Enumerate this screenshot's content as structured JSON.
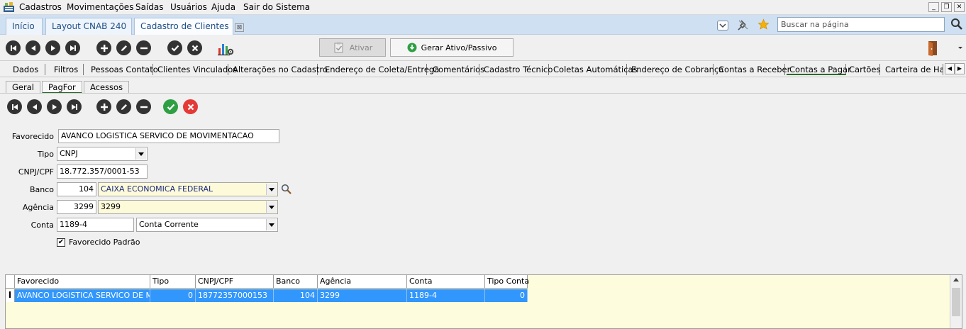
{
  "menu": {
    "items": [
      "Cadastros",
      "Movimentações",
      "Saídas",
      "Usuários",
      "Ajuda",
      "Sair do Sistema"
    ]
  },
  "window_controls": {
    "minimize": "_",
    "restore": "❐",
    "close": "✕"
  },
  "doc_tabs": [
    {
      "label": "Início"
    },
    {
      "label": "Layout CNAB 240"
    },
    {
      "label": "Cadastro de Clientes",
      "close": "⊠"
    }
  ],
  "search": {
    "placeholder": "Buscar na página",
    "value": ""
  },
  "toolbar": {
    "ativar_label": "Ativar",
    "gerar_label": "Gerar Ativo/Passivo"
  },
  "section_tabs": [
    "Dados",
    "Filtros",
    "Pessoas Contato",
    "Clientes Vinculados",
    "Alterações no Cadastro",
    "Endereço de Coleta/Entrega",
    "Comentários",
    "Cadastro Técnico",
    "Coletas Automáticas",
    "Endereço de Cobrança",
    "Contas a Receber",
    "Contas a Pagar",
    "Cartões",
    "Carteira de Habili"
  ],
  "active_section_tab": "Contas a Pagar",
  "sub_tabs": [
    "Geral",
    "PagFor",
    "Acessos"
  ],
  "active_sub_tab": "PagFor",
  "form": {
    "favorecido_label": "Favorecido",
    "favorecido_value": "AVANCO LOGISTICA SERVICO DE MOVIMENTACAO",
    "tipo_label": "Tipo",
    "tipo_value": "CNPJ",
    "cnpj_label": "CNPJ/CPF",
    "cnpj_value": "18.772.357/0001-53",
    "banco_label": "Banco",
    "banco_code": "104",
    "banco_name": "CAIXA ECONOMICA FEDERAL",
    "agencia_label": "Agência",
    "agencia_code": "3299",
    "agencia_value": "3299",
    "conta_label": "Conta",
    "conta_value": "1189-4",
    "conta_tipo": "Conta Corrente",
    "padrao_label": "Favorecido Padrão",
    "padrao_check": "✔"
  },
  "grid": {
    "columns": [
      "Favorecido",
      "Tipo",
      "CNPJ/CPF",
      "Banco",
      "Agência",
      "Conta",
      "Tipo Conta"
    ],
    "row_marker": "I",
    "rows": [
      [
        "AVANCO LOGISTICA SERVICO DE MO",
        "0",
        "18772357000153",
        "104",
        "3299",
        "1189-4",
        "0"
      ]
    ]
  },
  "colors": {
    "accent_tab_underline": "#2a6b2a",
    "grid_selection": "#3297fd",
    "field_highlight": "#fdfad9",
    "confirm_green": "#2ea043",
    "cancel_red": "#e53935"
  }
}
